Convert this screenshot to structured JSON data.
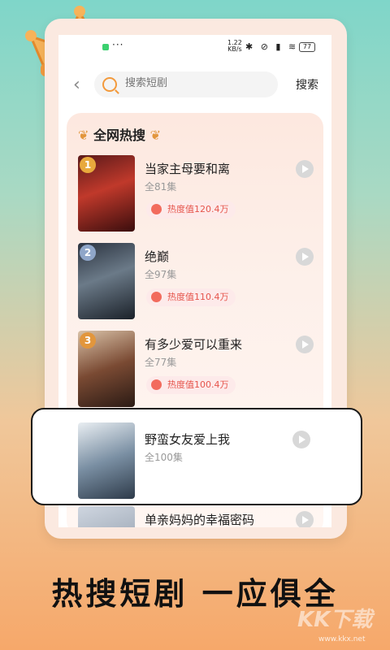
{
  "status": {
    "net_speed": "1.22\nKB/s",
    "battery": "77",
    "more": "···"
  },
  "search": {
    "placeholder": "搜索短剧",
    "button": "搜索"
  },
  "panel": {
    "title": "全网热搜"
  },
  "items": [
    {
      "rank": "1",
      "title": "当家主母要和离",
      "episodes": "全81集",
      "heat": "热度值120.4万",
      "rank_color": "#e8a93c"
    },
    {
      "rank": "2",
      "title": "绝巅",
      "episodes": "全97集",
      "heat": "热度值110.4万",
      "rank_color": "#8fa6c9"
    },
    {
      "rank": "3",
      "title": "有多少爱可以重来",
      "episodes": "全77集",
      "heat": "热度值100.4万",
      "rank_color": "#e2963c"
    },
    {
      "title": "野蛮女友爱上我",
      "episodes": "全100集"
    },
    {
      "title": "单亲妈妈的幸福密码"
    }
  ],
  "tagline": "热搜短剧 一应俱全",
  "watermark": {
    "brand": "KK下载",
    "url": "www.kkx.net"
  }
}
